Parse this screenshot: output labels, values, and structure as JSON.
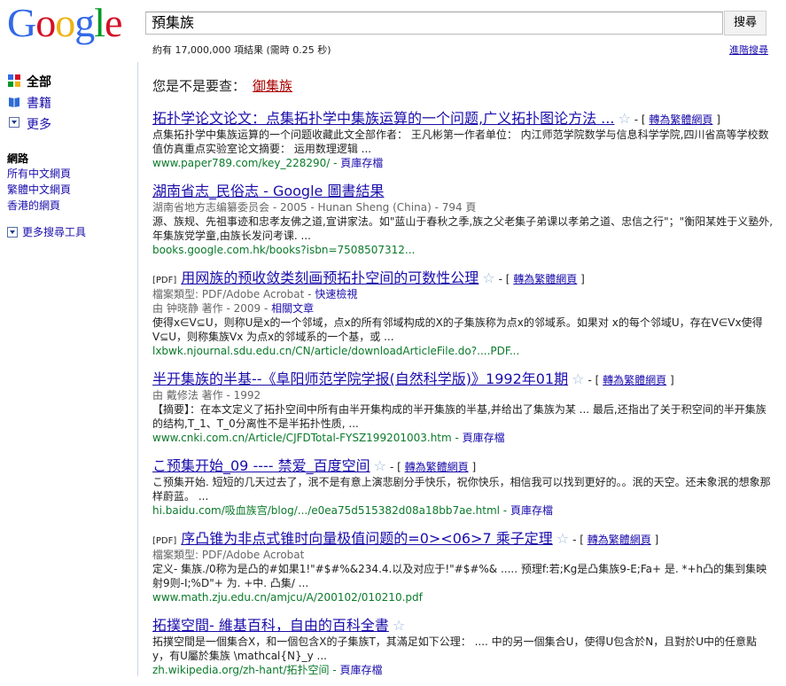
{
  "logo": {
    "letters": [
      "G",
      "o",
      "o",
      "g",
      "l",
      "e"
    ],
    "colors": [
      "#3369e8",
      "#d50f25",
      "#eeb211",
      "#3369e8",
      "#009925",
      "#d50f25"
    ]
  },
  "search": {
    "query": "預集族",
    "button": "搜尋"
  },
  "stats": "約有 17,000,000 項結果 (需時 0.25 秒)",
  "advanced": "進階搜尋",
  "left_nav": {
    "items": [
      {
        "label": "全部",
        "icon": "all-icon",
        "active": true
      },
      {
        "label": "書籍",
        "icon": "book-icon",
        "active": false
      },
      {
        "label": "更多",
        "icon": "more-icon",
        "active": false
      }
    ],
    "section_title": "網路",
    "links": [
      "所有中文網頁",
      "繁體中文網頁",
      "香港的網頁"
    ],
    "more_tools": "更多搜尋工具"
  },
  "did_you_mean": {
    "label": "您是不是要查：",
    "suggestion": "御集族"
  },
  "results": [
    {
      "pdf": "",
      "title": "拓扑学论文论文：点集拓扑学中集族运算的一个问题,广义拓扑图论方法 ...",
      "convert": "轉為繁體網頁",
      "meta": "",
      "meta_link": "",
      "snippet": "点集拓扑学中集族运算的一个问题收藏此文全部作者： 王凡彬第一作者单位： 内江师范学院数学与信息科学学院,四川省高等学校数值仿真重点实验室论文摘要： 运用数理逻辑 ...",
      "url": "www.paper789.com/key_228290/",
      "cache": "頁庫存檔"
    },
    {
      "pdf": "",
      "title": "湖南省志_民俗志 - Google 圖書結果",
      "convert": "",
      "meta": "湖南省地方志编纂委员会 - 2005 - Hunan Sheng (China) - 794 頁",
      "meta_link": "",
      "snippet": "源、族规、先祖事迹和忠孝友佛之道,宣讲家法。如\"蓝山于春秋之季,族之父老集子弟课以孝弟之道、忠信之行\"；\"衡阳某姓于义塾外,年集族党学童,由族长发问考课. ...",
      "url": "books.google.com.hk/books?isbn=7508507312...",
      "cache": ""
    },
    {
      "pdf": "[PDF]",
      "title": "用网族的预收敛类刻画预拓扑空间的可数性公理",
      "convert": "轉為繁體網頁",
      "meta": "檔案類型: PDF/Adobe Acrobat -",
      "meta_link": "快速檢視",
      "meta2": "由 钟晓静 著作 - 2009 -",
      "meta2_link": "相關文章",
      "snippet": "使得x∈V⊆U，则称U是x的一个邻域，点x的所有邻域构成的X的子集族称为点x的邻域系。如果对 x的每个邻域U，存在V∈Vx使得V⊆U，则称集族Vx 为点x的邻域系的一个基，或 ...",
      "url": "lxbwk.njournal.sdu.edu.cn/CN/article/downloadArticleFile.do?....PDF...",
      "cache": ""
    },
    {
      "pdf": "",
      "title": "半开集族的半基--《阜阳师范学院学报(自然科学版)》1992年01期",
      "convert": "轉為繁體網頁",
      "meta": "由 戴修法 著作 - 1992",
      "meta_link": "",
      "snippet": "【摘要】：在本文定义了拓扑空间中所有由半开集构成的半开集族的半基,并给出了集族为某 ... 最后,还指出了关于积空间的半开集族的结构,T_1、T_0分离性不是半拓扑性质, ...",
      "url": "www.cnki.com.cn/Article/CJFDTotal-FYSZ199201003.htm",
      "cache": "頁庫存檔"
    },
    {
      "pdf": "",
      "title": "こ预集开始_09 ---- 禁爱_百度空间",
      "convert": "轉為繁體網頁",
      "meta": "",
      "meta_link": "",
      "snippet": "こ预集开始. 短短的几天过去了，泯不是有意上演悲剧分手快乐，祝你快乐，相信我可以找到更好的。。泯的天空。还未象泯的想象那样蔚蓝。 ...",
      "url": "hi.baidu.com/吸血族宫/blog/.../e0ea75d515382d08a18bb7ae.html",
      "cache": "頁庫存檔"
    },
    {
      "pdf": "[PDF]",
      "title": "序凸锥为非点式锥时向量极值问题的=0><06>7 乘子定理",
      "convert": "轉為繁體網頁",
      "meta": "檔案類型: PDF/Adobe Acrobat",
      "meta_link": "",
      "snippet": "定义- 集族./0称为是凸的#如果1!\"#$#%&234.4.以及对应于!\"#$#%& ..... 预理f:若;Kg是凸集族9-E;Fa+ 是. *+h凸的集到集映射9则-I;%D\"+ 为. +中. 凸集/ ...",
      "url": "www.math.zju.edu.cn/amjcu/A/200102/010210.pdf",
      "cache": ""
    },
    {
      "pdf": "",
      "title": "拓撲空間- 維基百科，自由的百科全書",
      "convert": "",
      "meta": "",
      "meta_link": "",
      "snippet": "拓撲空間是一個集合X，和一個包含X的子集族T，其滿足如下公理： .... 中的另一個集合U，使得U包含於N，且對於U中的任意點y，有U屬於集族 \\mathcal{N}_y ...",
      "url": "zh.wikipedia.org/zh-hant/拓扑空间",
      "cache": "頁庫存檔"
    }
  ]
}
